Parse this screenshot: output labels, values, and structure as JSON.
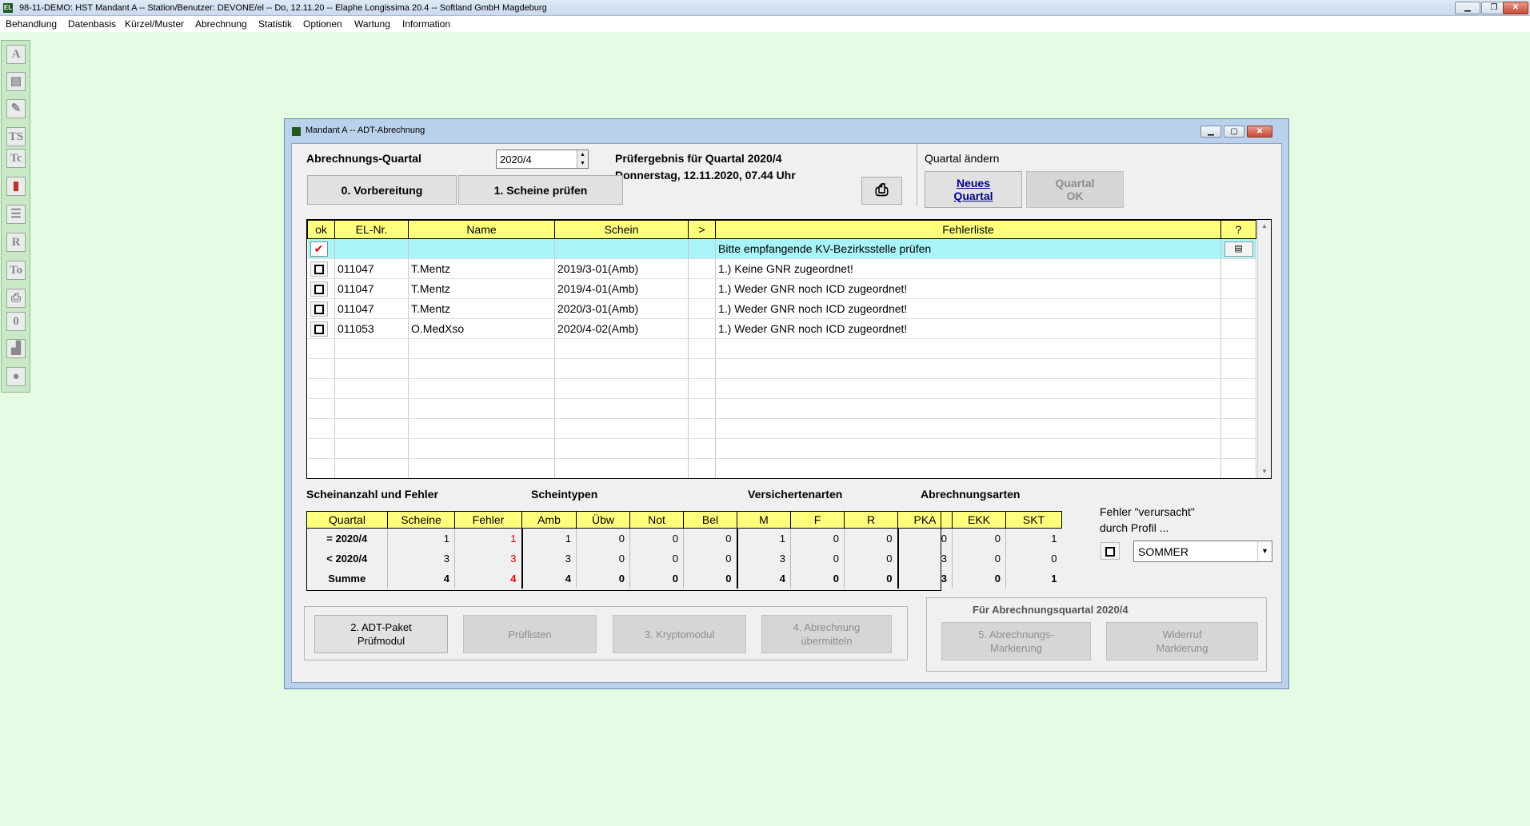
{
  "app": {
    "title": "98-11-DEMO: HST Mandant A -- Station/Benutzer: DEVONE/el -- Do, 12.11.20 -- Elaphe Longissima 20.4 -- Softland GmbH Magdeburg",
    "logo": "EL"
  },
  "menu": [
    "Behandlung",
    "Datenbasis",
    "Kürzel/Muster",
    "Abrechnung",
    "Statistik",
    "Optionen",
    "Wartung",
    "Information"
  ],
  "toolbar": [
    "A",
    "",
    "",
    "TS",
    "Tc",
    "",
    "",
    "R",
    "To",
    "",
    "0",
    "",
    ""
  ],
  "dialog": {
    "title": "Mandant A -- ADT-Abrechnung",
    "quarter_label": "Abrechnungs-Quartal",
    "quarter_value": "2020/4",
    "prep_button": "0. Vorbereitung",
    "check_button": "1. Scheine prüfen",
    "result_line1": "Prüfergebnis für Quartal 2020/4",
    "result_line2": "Donnerstag, 12.11.2020, 07.44 Uhr",
    "change_quarter_label": "Quartal ändern",
    "new_quarter_button": "Neues\nQuartal",
    "quarter_ok_button": "Quartal\nOK"
  },
  "error_table": {
    "columns": [
      "ok",
      "EL-Nr.",
      "Name",
      "Schein",
      ">",
      "Fehlerliste",
      "?"
    ],
    "rows": [
      {
        "ok": "checked",
        "el_nr": "",
        "name": "",
        "schein": "",
        "gt": "",
        "fehler": "Bitte empfangende KV-Bezirksstelle prüfen",
        "info": "doc"
      },
      {
        "ok": "unchecked",
        "el_nr": "011047",
        "name": "T.Mentz",
        "schein": "2019/3-01(Amb)",
        "gt": "",
        "fehler": "1.) Keine GNR zugeordnet!",
        "info": ""
      },
      {
        "ok": "unchecked",
        "el_nr": "011047",
        "name": "T.Mentz",
        "schein": "2019/4-01(Amb)",
        "gt": "",
        "fehler": "1.) Weder GNR noch ICD zugeordnet!",
        "info": ""
      },
      {
        "ok": "unchecked",
        "el_nr": "011047",
        "name": "T.Mentz",
        "schein": "2020/3-01(Amb)",
        "gt": "",
        "fehler": "1.) Weder GNR noch ICD zugeordnet!",
        "info": ""
      },
      {
        "ok": "unchecked",
        "el_nr": "011053",
        "name": "O.MedXso",
        "schein": "2020/4-02(Amb)",
        "gt": "",
        "fehler": "1.) Weder GNR noch ICD zugeordnet!",
        "info": ""
      }
    ]
  },
  "stats": {
    "group_labels": [
      "Scheinanzahl und Fehler",
      "Scheintypen",
      "Versichertenarten",
      "Abrechnungsarten"
    ],
    "columns": [
      "Quartal",
      "Scheine",
      "Fehler",
      "Amb",
      "Übw",
      "Not",
      "Bel",
      "M",
      "F",
      "R",
      "PKA",
      "EKK",
      "SKT"
    ],
    "rows": [
      {
        "label": "= 2020/4",
        "values": [
          "1",
          "1",
          "1",
          "0",
          "0",
          "0",
          "1",
          "0",
          "0",
          "0",
          "0",
          "1"
        ]
      },
      {
        "label": "< 2020/4",
        "values": [
          "3",
          "3",
          "3",
          "0",
          "0",
          "0",
          "3",
          "0",
          "0",
          "3",
          "0",
          "0"
        ]
      },
      {
        "label": "Summe",
        "values": [
          "4",
          "4",
          "4",
          "0",
          "0",
          "0",
          "4",
          "0",
          "0",
          "3",
          "0",
          "1"
        ]
      }
    ]
  },
  "profile": {
    "label": "Fehler \"verursacht\"\ndurch Profil ...",
    "value": "SOMMER"
  },
  "actions": {
    "adt_button": "2. ADT-Paket\nPrüfmodul",
    "pruef_button": "Prüflisten",
    "krypto_button": "3. Kryptomodul",
    "send_button": "4. Abrechnung\nübermitteln",
    "quarter_group_label": "Für Abrechnungsquartal 2020/4",
    "mark_button": "5. Abrechnungs-\nMarkierung",
    "revoke_button": "Widerruf\nMarkierung"
  },
  "colors": {
    "background": "#e3fce3",
    "header_yellow": "#ffff7e",
    "highlight_row": "#a8f4f8",
    "error_red": "#e00000"
  }
}
